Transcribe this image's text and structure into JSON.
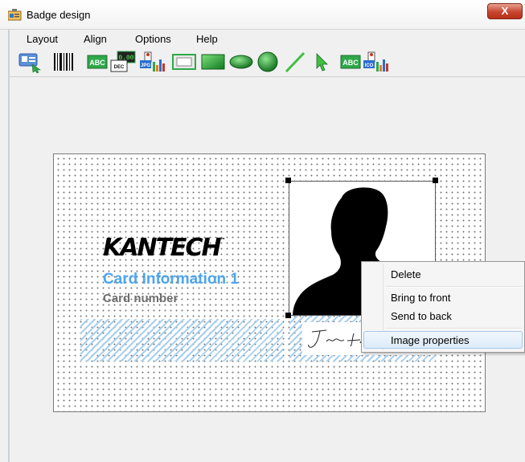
{
  "window": {
    "title": "Badge design",
    "close_label": "X"
  },
  "menu": {
    "items": [
      "Layout",
      "Align",
      "Options",
      "Help"
    ]
  },
  "toolbar": {
    "tools": [
      {
        "name": "card-select-tool",
        "icon": "card-arrow-icon"
      },
      {
        "name": "barcode-tool",
        "icon": "barcode-icon",
        "label": ""
      },
      {
        "name": "text-tool",
        "icon": "text-abc-icon",
        "label": "ABC"
      },
      {
        "name": "counter-tool",
        "icon": "counter-dec-icon",
        "label": "DEC",
        "value": "0.00"
      },
      {
        "name": "photo-tool",
        "icon": "photo-jpg-icon",
        "label": "JPG"
      },
      {
        "name": "rectangle-tool",
        "icon": "rectangle-outline-icon"
      },
      {
        "name": "filled-rectangle-tool",
        "icon": "rectangle-filled-icon"
      },
      {
        "name": "ellipse-tool",
        "icon": "ellipse-icon"
      },
      {
        "name": "circle-tool",
        "icon": "circle-icon"
      },
      {
        "name": "line-tool",
        "icon": "line-icon"
      },
      {
        "name": "pointer-tool",
        "icon": "pointer-arrow-icon"
      },
      {
        "name": "text-field-tool",
        "icon": "text-abc-field-icon",
        "label": "ABC"
      },
      {
        "name": "image-ico-tool",
        "icon": "image-ico-icon",
        "label": "ICO"
      }
    ]
  },
  "badge": {
    "logo": "KANTECH",
    "logo_tm": "™",
    "card_info": "Card Information 1",
    "card_number": "Card number"
  },
  "context_menu": {
    "items": [
      "Delete",
      "Bring to front",
      "Send to back",
      "Image properties"
    ],
    "highlighted": "Image properties"
  },
  "colors": {
    "card_info": "#4da6f0",
    "card_number": "#6e6e6e",
    "hatch": "#a8d0ef",
    "highlight": "#dcebfa"
  }
}
